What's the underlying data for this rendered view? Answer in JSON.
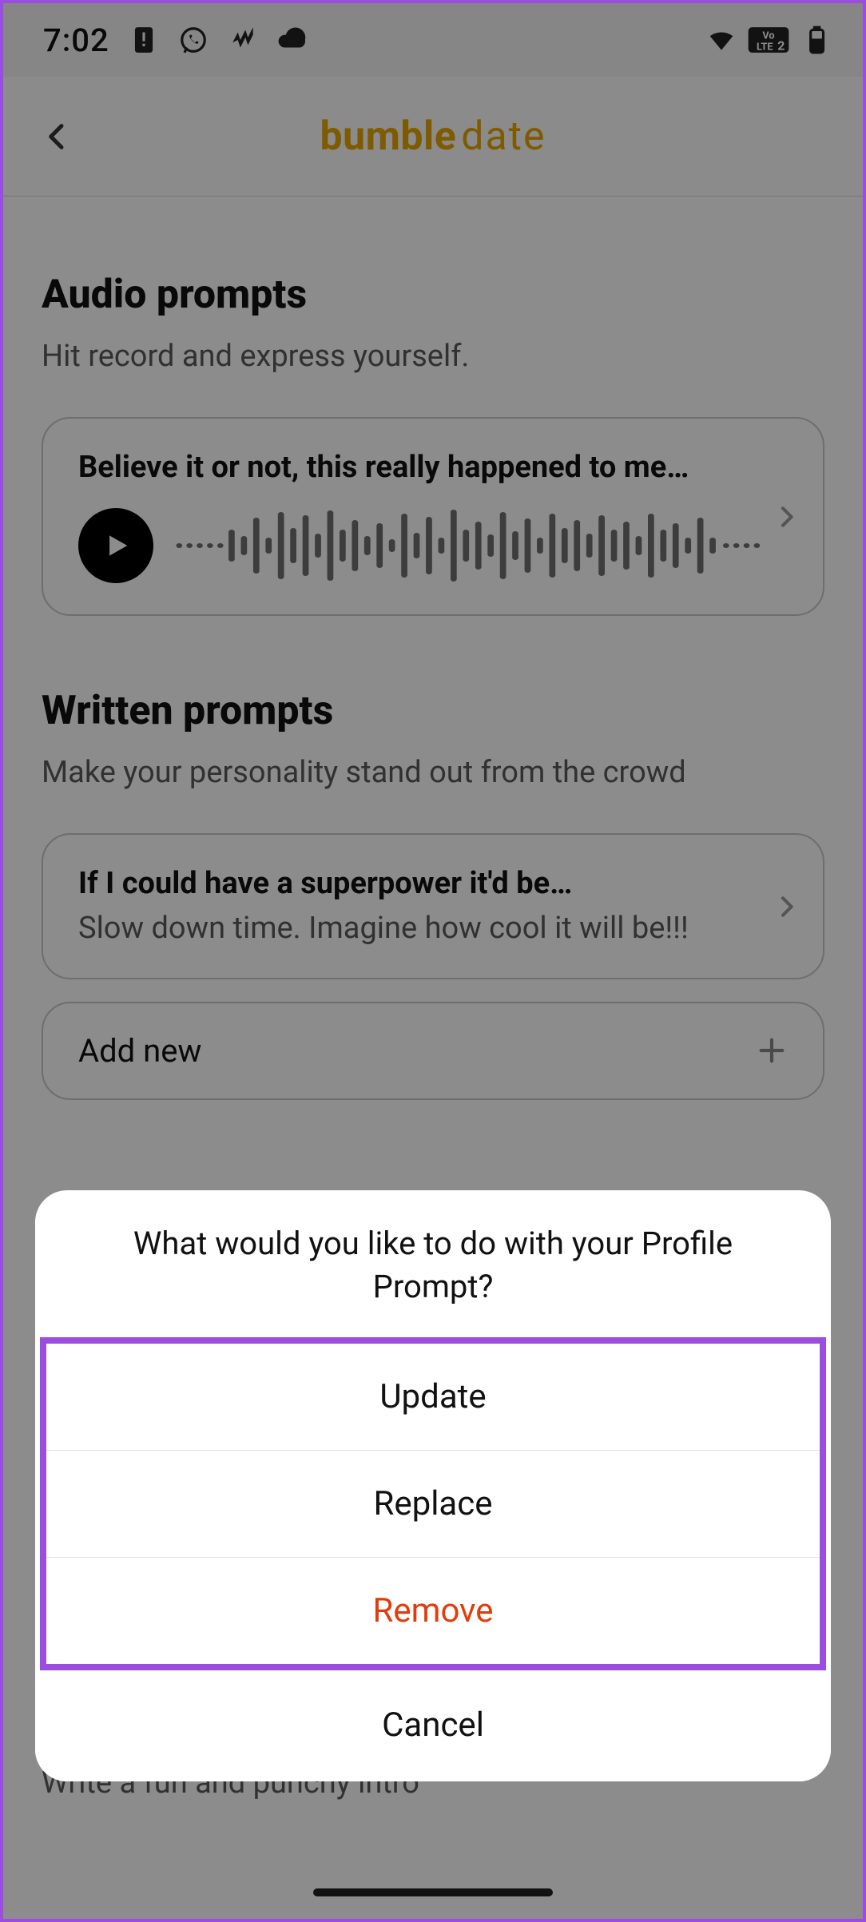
{
  "status": {
    "time": "7:02",
    "icons_left": [
      "card-alert-icon",
      "whatsapp-icon",
      "vibrate-icon",
      "cloud-icon"
    ],
    "icons_right": [
      "wifi-icon",
      "volte2-icon",
      "battery-icon"
    ]
  },
  "header": {
    "logo_a": "bumble",
    "logo_b": "date"
  },
  "audio_section": {
    "title": "Audio prompts",
    "subtitle": "Hit record and express yourself.",
    "card_title": "Believe it or not, this really happened to me…"
  },
  "written_section": {
    "title": "Written prompts",
    "subtitle": "Make your personality stand out from the crowd",
    "cards": [
      {
        "title": "If I could have a superpower it'd be…",
        "body": "Slow down time. Imagine how cool it will be!!!"
      }
    ],
    "add_new_label": "Add new"
  },
  "truncated_text": "Write a fun and punchy intro",
  "sheet": {
    "title": "What would you like to do with your Profile Prompt?",
    "options": [
      {
        "label": "Update",
        "danger": false
      },
      {
        "label": "Replace",
        "danger": false
      },
      {
        "label": "Remove",
        "danger": true
      }
    ],
    "cancel": "Cancel"
  }
}
